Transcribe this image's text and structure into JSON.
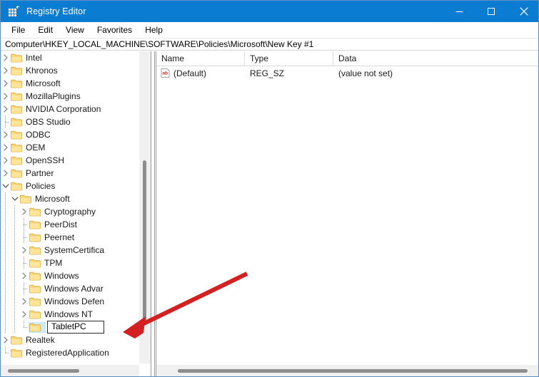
{
  "window": {
    "title": "Registry Editor",
    "app_icon": "registry-grid-icon",
    "controls": {
      "minimize": "minimize-icon",
      "maximize": "maximize-icon",
      "close": "close-icon"
    },
    "titlebar_color": "#0a7cd1"
  },
  "menubar": {
    "items": [
      "File",
      "Edit",
      "View",
      "Favorites",
      "Help"
    ]
  },
  "address": {
    "path": "Computer\\HKEY_LOCAL_MACHINE\\SOFTWARE\\Policies\\Microsoft\\New Key #1"
  },
  "tree": {
    "nodes": [
      {
        "label": "Intel",
        "indent": 1,
        "twisty": "collapsed",
        "guide": "v"
      },
      {
        "label": "Khronos",
        "indent": 1,
        "twisty": "collapsed",
        "guide": "v"
      },
      {
        "label": "Microsoft",
        "indent": 1,
        "twisty": "collapsed",
        "guide": "v"
      },
      {
        "label": "MozillaPlugins",
        "indent": 1,
        "twisty": "collapsed",
        "guide": "v"
      },
      {
        "label": "NVIDIA Corporation",
        "indent": 1,
        "twisty": "collapsed",
        "guide": "v"
      },
      {
        "label": "OBS Studio",
        "indent": 1,
        "twisty": "none",
        "guide": "t"
      },
      {
        "label": "ODBC",
        "indent": 1,
        "twisty": "collapsed",
        "guide": "v"
      },
      {
        "label": "OEM",
        "indent": 1,
        "twisty": "collapsed",
        "guide": "v"
      },
      {
        "label": "OpenSSH",
        "indent": 1,
        "twisty": "collapsed",
        "guide": "v"
      },
      {
        "label": "Partner",
        "indent": 1,
        "twisty": "collapsed",
        "guide": "v"
      },
      {
        "label": "Policies",
        "indent": 1,
        "twisty": "expanded",
        "guide": "v"
      },
      {
        "label": "Microsoft",
        "indent": 2,
        "twisty": "expanded",
        "guide": "v"
      },
      {
        "label": "Cryptography",
        "indent": 3,
        "twisty": "collapsed",
        "guide": "v"
      },
      {
        "label": "PeerDist",
        "indent": 3,
        "twisty": "none",
        "guide": "t"
      },
      {
        "label": "Peernet",
        "indent": 3,
        "twisty": "none",
        "guide": "t"
      },
      {
        "label": "SystemCertifica",
        "indent": 3,
        "twisty": "collapsed",
        "guide": "v"
      },
      {
        "label": "TPM",
        "indent": 3,
        "twisty": "none",
        "guide": "t"
      },
      {
        "label": "Windows",
        "indent": 3,
        "twisty": "collapsed",
        "guide": "v"
      },
      {
        "label": "Windows Advar",
        "indent": 3,
        "twisty": "none",
        "guide": "t"
      },
      {
        "label": "Windows Defen",
        "indent": 3,
        "twisty": "collapsed",
        "guide": "v"
      },
      {
        "label": "Windows NT",
        "indent": 3,
        "twisty": "collapsed",
        "guide": "v"
      },
      {
        "label": "",
        "indent": 3,
        "twisty": "none",
        "guide": "l",
        "editing": true,
        "edit_value": "TabletPC",
        "selected": true
      },
      {
        "label": "Realtek",
        "indent": 1,
        "twisty": "collapsed",
        "guide": "v"
      },
      {
        "label": "RegisteredApplication",
        "indent": 1,
        "twisty": "none",
        "guide": "l"
      }
    ],
    "rename_value": "TabletPC"
  },
  "list": {
    "columns": [
      "Name",
      "Type",
      "Data"
    ],
    "rows": [
      {
        "icon": "string-value-ab-icon",
        "name": "(Default)",
        "type": "REG_SZ",
        "data": "(value not set)"
      }
    ]
  },
  "annotation": {
    "arrow_color": "#d32020",
    "arrow_name": "red-pointer-arrow"
  },
  "scrollbars": {
    "tree_vertical": "tree-vertical-scrollbar",
    "tree_horizontal": "tree-horizontal-scrollbar",
    "list_horizontal": "list-horizontal-scrollbar"
  }
}
